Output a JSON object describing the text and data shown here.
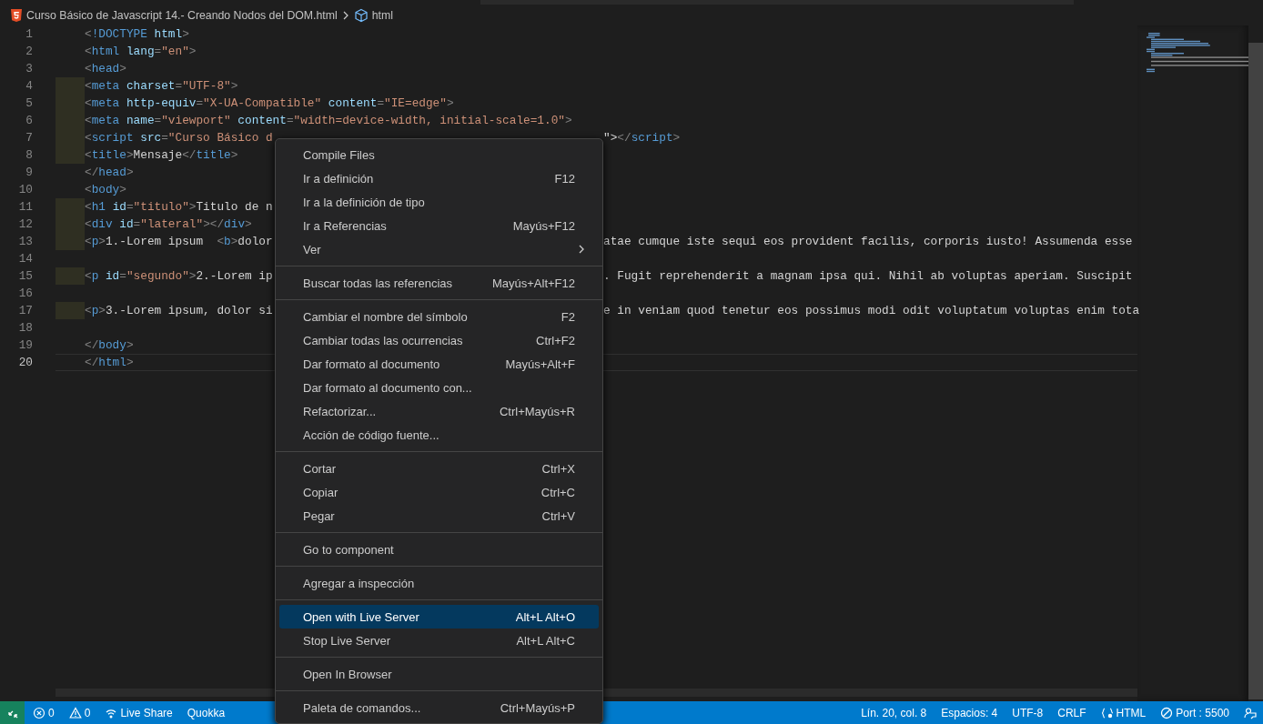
{
  "breadcrumb": {
    "file": "Curso Básico de Javascript 14.- Creando Nodos del DOM.html",
    "symbol": "html"
  },
  "code_lines": [
    {
      "number": "1",
      "left": "<!DOCTYPE html>",
      "indented": false,
      "current": false
    },
    {
      "number": "2",
      "left": "<html lang=\"en\">",
      "indented": false,
      "current": false
    },
    {
      "number": "3",
      "left": "<head>",
      "indented": false,
      "current": false
    },
    {
      "number": "4",
      "left": "<meta charset=\"UTF-8\">",
      "indented": true,
      "current": false
    },
    {
      "number": "5",
      "left": "<meta http-equiv=\"X-UA-Compatible\" content=\"IE=edge\">",
      "indented": true,
      "current": false
    },
    {
      "number": "6",
      "left": "<meta name=\"viewport\" content=\"width=device-width, initial-scale=1.0\">",
      "indented": true,
      "current": false
    },
    {
      "number": "7",
      "left": "<script src=\"Curso Básico d",
      "right": "\"></script>",
      "indented": true,
      "current": false
    },
    {
      "number": "8",
      "left": "<title>Mensaje</title>",
      "indented": true,
      "current": false
    },
    {
      "number": "9",
      "left": "</head>",
      "indented": false,
      "current": false
    },
    {
      "number": "10",
      "left": "<body>",
      "indented": false,
      "current": false
    },
    {
      "number": "11",
      "left": "<h1 id=\"titulo\">Titulo de n",
      "indented": true,
      "current": false
    },
    {
      "number": "12",
      "left": "<div id=\"lateral\"></div>",
      "indented": true,
      "current": false
    },
    {
      "number": "13",
      "left": "<p>1.-Lorem ipsum  <b>dolor",
      "right": "atae cumque iste sequi eos provident facilis, corporis iusto! Assumenda esse",
      "indented": true,
      "current": false
    },
    {
      "number": "14",
      "indented": false,
      "current": false
    },
    {
      "number": "15",
      "left": "<p id=\"segundo\">2.-Lorem ip",
      "right": ". Fugit reprehenderit a magnam ipsa qui. Nihil ab voluptas aperiam. Suscipit",
      "indented": true,
      "current": false
    },
    {
      "number": "16",
      "indented": false,
      "current": false
    },
    {
      "number": "17",
      "left": "<p>3.-Lorem ipsum, dolor si",
      "right": "e in veniam quod tenetur eos possimus modi odit voluptatum voluptas enim tota",
      "indented": true,
      "current": false
    },
    {
      "number": "18",
      "indented": false,
      "current": false
    },
    {
      "number": "19",
      "left": "</body>",
      "indented": false,
      "current": false
    },
    {
      "number": "20",
      "left": "</html>",
      "indented": false,
      "current": true
    }
  ],
  "context_menu": [
    {
      "kind": "item",
      "label": "Compile Files",
      "selected": false
    },
    {
      "kind": "item",
      "label": "Ir a definición",
      "shortcut": "F12",
      "selected": false
    },
    {
      "kind": "item",
      "label": "Ir a la definición de tipo",
      "selected": false
    },
    {
      "kind": "item",
      "label": "Ir a Referencias",
      "shortcut": "Mayús+F12",
      "selected": false
    },
    {
      "kind": "submenu",
      "label": "Ver",
      "selected": false
    },
    {
      "kind": "separator"
    },
    {
      "kind": "item",
      "label": "Buscar todas las referencias",
      "shortcut": "Mayús+Alt+F12",
      "selected": false
    },
    {
      "kind": "separator"
    },
    {
      "kind": "item",
      "label": "Cambiar el nombre del símbolo",
      "shortcut": "F2",
      "selected": false
    },
    {
      "kind": "item",
      "label": "Cambiar todas las ocurrencias",
      "shortcut": "Ctrl+F2",
      "selected": false
    },
    {
      "kind": "item",
      "label": "Dar formato al documento",
      "shortcut": "Mayús+Alt+F",
      "selected": false
    },
    {
      "kind": "item",
      "label": "Dar formato al documento con...",
      "selected": false
    },
    {
      "kind": "item",
      "label": "Refactorizar...",
      "shortcut": "Ctrl+Mayús+R",
      "selected": false
    },
    {
      "kind": "item",
      "label": "Acción de código fuente...",
      "selected": false
    },
    {
      "kind": "separator"
    },
    {
      "kind": "item",
      "label": "Cortar",
      "shortcut": "Ctrl+X",
      "selected": false
    },
    {
      "kind": "item",
      "label": "Copiar",
      "shortcut": "Ctrl+C",
      "selected": false
    },
    {
      "kind": "item",
      "label": "Pegar",
      "shortcut": "Ctrl+V",
      "selected": false
    },
    {
      "kind": "separator"
    },
    {
      "kind": "item",
      "label": "Go to component",
      "selected": false
    },
    {
      "kind": "separator"
    },
    {
      "kind": "item",
      "label": "Agregar a inspección",
      "selected": false
    },
    {
      "kind": "separator"
    },
    {
      "kind": "item",
      "label": "Open with Live Server",
      "shortcut": "Alt+L Alt+O",
      "selected": true
    },
    {
      "kind": "item",
      "label": "Stop Live Server",
      "shortcut": "Alt+L Alt+C",
      "selected": false
    },
    {
      "kind": "separator"
    },
    {
      "kind": "item",
      "label": "Open In Browser",
      "selected": false
    },
    {
      "kind": "separator"
    },
    {
      "kind": "item",
      "label": "Paleta de comandos...",
      "shortcut": "Ctrl+Mayús+P",
      "selected": false
    }
  ],
  "status_bar": {
    "left": [
      {
        "kind": "remote"
      },
      {
        "kind": "error",
        "text": "0"
      },
      {
        "kind": "warning",
        "text": "0"
      },
      {
        "kind": "live-share",
        "text": "Live Share"
      },
      {
        "text": "Quokka"
      }
    ],
    "right": [
      {
        "text": "Lín. 20, col. 8"
      },
      {
        "text": "Espacios: 4"
      },
      {
        "text": "UTF-8"
      },
      {
        "text": "CRLF"
      },
      {
        "kind": "braces",
        "text": "HTML"
      },
      {
        "kind": "port",
        "text": "Port : 5500"
      },
      {
        "kind": "feedback"
      }
    ]
  }
}
